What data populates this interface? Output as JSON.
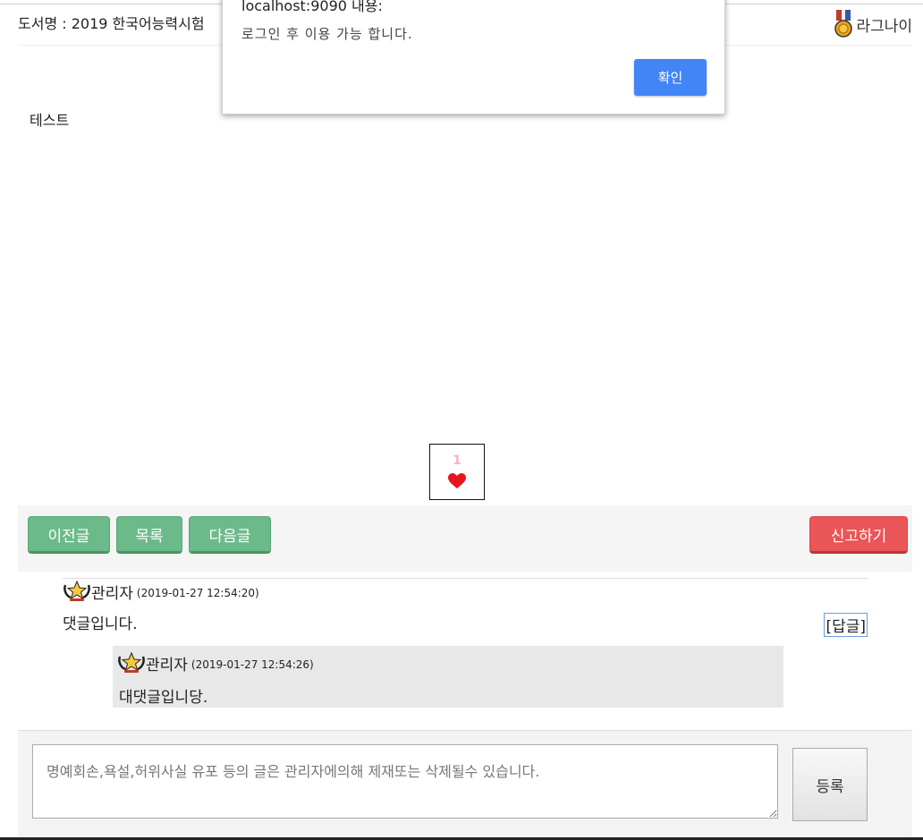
{
  "header": {
    "book_title": "도서명 : 2019 한국어능력시험",
    "username": "라그나이"
  },
  "post": {
    "body": "테스트",
    "like_count": "1"
  },
  "actions": {
    "prev_label": "이전글",
    "list_label": "목록",
    "next_label": "다음글",
    "report_label": "신고하기"
  },
  "comments": [
    {
      "author": "관리자",
      "date": "(2019-01-27 12:54:20)",
      "text": "댓글입니다.",
      "reply_label": "[답글]",
      "replies": [
        {
          "author": "관리자",
          "date": "(2019-01-27 12:54:26)",
          "text": "대댓글입니당."
        }
      ]
    }
  ],
  "comment_form": {
    "placeholder": "명예회손,욕설,허위사실 유포 등의 글은 관리자에의해 제재또는 삭제될수 있습니다.",
    "submit_label": "등록"
  },
  "dialog": {
    "host": "localhost:9090 내용:",
    "message": "로그인 후 이용 가능 합니다.",
    "ok_label": "확인"
  },
  "colors": {
    "green_button": "#6cba8a",
    "red_button": "#ea5557",
    "dialog_button": "#4285f4",
    "heart": "#e8151c"
  }
}
